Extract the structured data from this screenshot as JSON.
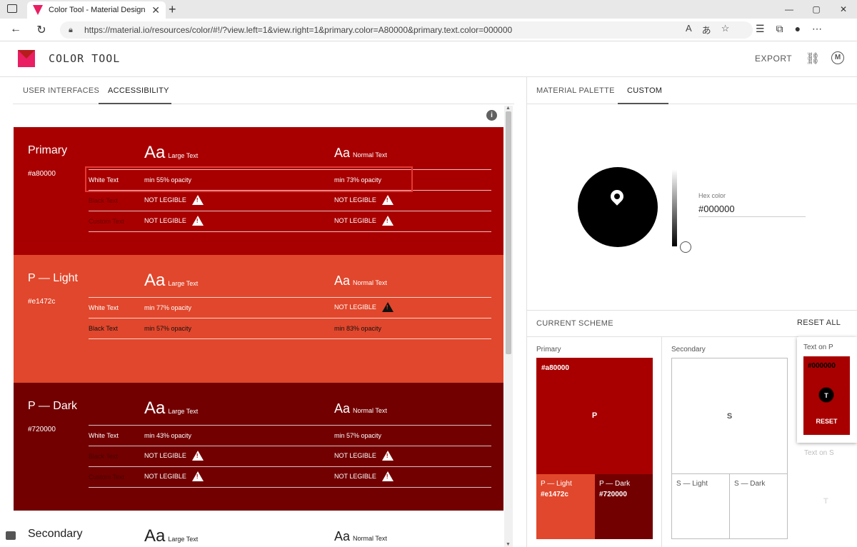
{
  "browser": {
    "tab_title": "Color Tool - Material Design",
    "tab_close": "✕",
    "new_tab": "+",
    "url": "https://material.io/resources/color/#!/?view.left=1&view.right=1&primary.color=A80000&primary.text.color=000000",
    "win_min": "—",
    "win_max": "▢",
    "win_close": "✕"
  },
  "header": {
    "title": "COLOR TOOL",
    "export": "EXPORT"
  },
  "left_tabs": [
    "USER INTERFACES",
    "ACCESSIBILITY"
  ],
  "right_tabs": [
    "MATERIAL PALETTE",
    "CUSTOM"
  ],
  "accessibility": {
    "large_text": "Large Text",
    "normal_text": "Normal Text",
    "aa": "Aa",
    "blocks": [
      {
        "name": "Primary",
        "hex": "#a80000",
        "bg": "#a80000",
        "rows": [
          {
            "label": "White Text",
            "large": "min 55% opacity",
            "normal": "min 73% opacity"
          },
          {
            "label": "Black Text",
            "large": "NOT LEGIBLE",
            "normal": "NOT LEGIBLE"
          },
          {
            "label": "Custom Text",
            "large": "NOT LEGIBLE",
            "normal": "NOT LEGIBLE"
          }
        ]
      },
      {
        "name": "P — Light",
        "hex": "#e1472c",
        "bg": "#e1472c",
        "rows": [
          {
            "label": "White Text",
            "large": "min 77% opacity",
            "normal": "NOT LEGIBLE"
          },
          {
            "label": "Black Text",
            "large": "min 57% opacity",
            "normal": "min 83% opacity"
          }
        ]
      },
      {
        "name": "P — Dark",
        "hex": "#720000",
        "bg": "#720000",
        "rows": [
          {
            "label": "White Text",
            "large": "min 43% opacity",
            "normal": "min 57% opacity"
          },
          {
            "label": "Black Text",
            "large": "NOT LEGIBLE",
            "normal": "NOT LEGIBLE"
          },
          {
            "label": "Custom Text",
            "large": "NOT LEGIBLE",
            "normal": "NOT LEGIBLE"
          }
        ]
      },
      {
        "name": "Secondary"
      }
    ]
  },
  "custom": {
    "hex_label": "Hex color",
    "hex_value": "#000000"
  },
  "scheme": {
    "title": "CURRENT SCHEME",
    "reset_all": "RESET ALL",
    "primary_label": "Primary",
    "secondary_label": "Secondary",
    "primary_hex": "#a80000",
    "primary_letter": "P",
    "plight_label": "P — Light",
    "plight_hex": "#e1472c",
    "pdark_label": "P — Dark",
    "pdark_hex": "#720000",
    "secondary_letter": "S",
    "slight_label": "S — Light",
    "sdark_label": "S — Dark",
    "text_on_p": "Text on P",
    "text_on_p_hex": "#000000",
    "text_on_p_letter": "T",
    "reset": "RESET",
    "text_on_s": "Text on S",
    "text_on_s_letter": "T"
  },
  "colors": {
    "primary": "#a80000",
    "primary_light": "#e1472c",
    "primary_dark": "#720000"
  }
}
